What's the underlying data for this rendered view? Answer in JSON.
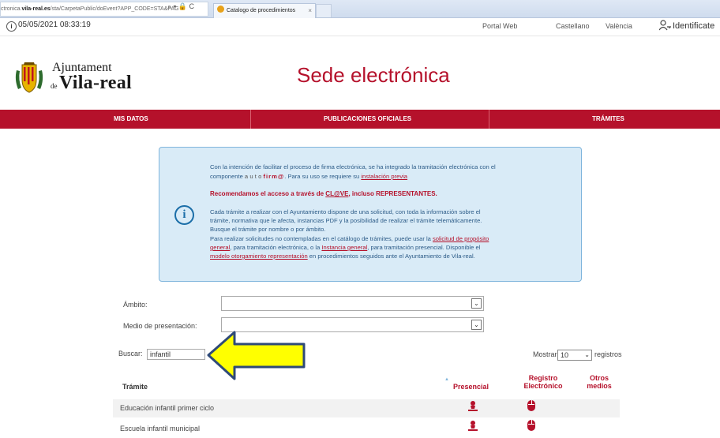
{
  "browser": {
    "url_prefix": "ctronica.",
    "url_domain": "vila-real.es",
    "url_rest": "/sta/CarpetaPublic/doEvent?APP_CODE=STA&PAG",
    "url_icons": "⌕ ▾ 🔒 C",
    "tab_title": "Catalogo de procedimientos",
    "tab_close": "×"
  },
  "topbar": {
    "clock_icon": "clock-icon",
    "datetime": "05/05/2021 08:33:19",
    "links": [
      "Portal Web",
      "Castellano",
      "València"
    ],
    "login_icon": "user-key-icon",
    "login_label": "Identificate"
  },
  "header": {
    "logo_line1": "Ajuntament",
    "logo_de": "de",
    "logo_line2": "Vila-real",
    "title": "Sede electrónica"
  },
  "nav": {
    "items": [
      "MIS DATOS",
      "PUBLICACIONES OFICIALES",
      "TRÁMITES"
    ],
    "bg_color": "#b5112b"
  },
  "info": {
    "icon": "info-icon",
    "p1a": "Con la intención de facilitar el proceso de firma electrónica, se ha integrado la tramitación electrónica con el",
    "p1b_pre": "componente ",
    "p1b_autof": "auto",
    "p1b_firma": "firm@",
    "p1b_mid": ". Para su uso se requiere su ",
    "p1b_link": "instalación previa",
    "p2_pre": "Recomendamos el acceso a través de ",
    "p2_link": "CL@VE",
    "p2_post": ", incluso REPRESENTANTES.",
    "p3a": "Cada trámite a realizar con el Ayuntamiento dispone de una solicitud, con toda la información sobre el",
    "p3b": "trámite, normativa que le afecta, instancias PDF y la posibilidad de realizar el trámite telemáticamente.",
    "p3c": "Busque el trámite por nombre o por ámbito.",
    "p4a_pre": "Para realizar solicitudes no contempladas en el catálogo de trámites, puede usar la ",
    "p4a_link": "solicitud de propósito",
    "p4b_link": "general",
    "p4b_mid": ", para tramitación electrónica, o la ",
    "p4b_link2": "Instancia general",
    "p4b_post": ", para tramitación presencial. Disponible el",
    "p4c_link": "modelo otorgamiento representación",
    "p4c_post": " en procedimientos seguidos ante el Ayuntamiento de Vila-real."
  },
  "filters": {
    "ambito_label": "Ámbito:",
    "ambito_value": "",
    "medio_label": "Medio de presentación:",
    "medio_value": "",
    "buscar_label": "Buscar:",
    "buscar_value": "infantil",
    "mostrar_label": "Mostrar",
    "mostrar_value": "10",
    "registros_label": "registros"
  },
  "table": {
    "col_tramite": "Trámite",
    "col_presencial": "Presencial",
    "col_registro_1": "Registro",
    "col_registro_2": "Electrónico",
    "col_otros_1": "Otros",
    "col_otros_2": "medios",
    "rows": [
      {
        "name": "Educación infantil primer ciclo",
        "presencial_icon": "person-icon",
        "electronico_icon": "mouse-icon"
      },
      {
        "name": "Escuela infantil municipal",
        "presencial_icon": "person-icon",
        "electronico_icon": "mouse-icon"
      }
    ]
  },
  "annotation": {
    "arrow_icon": "yellow-arrow-icon",
    "arrow_color": "#ffff00"
  }
}
